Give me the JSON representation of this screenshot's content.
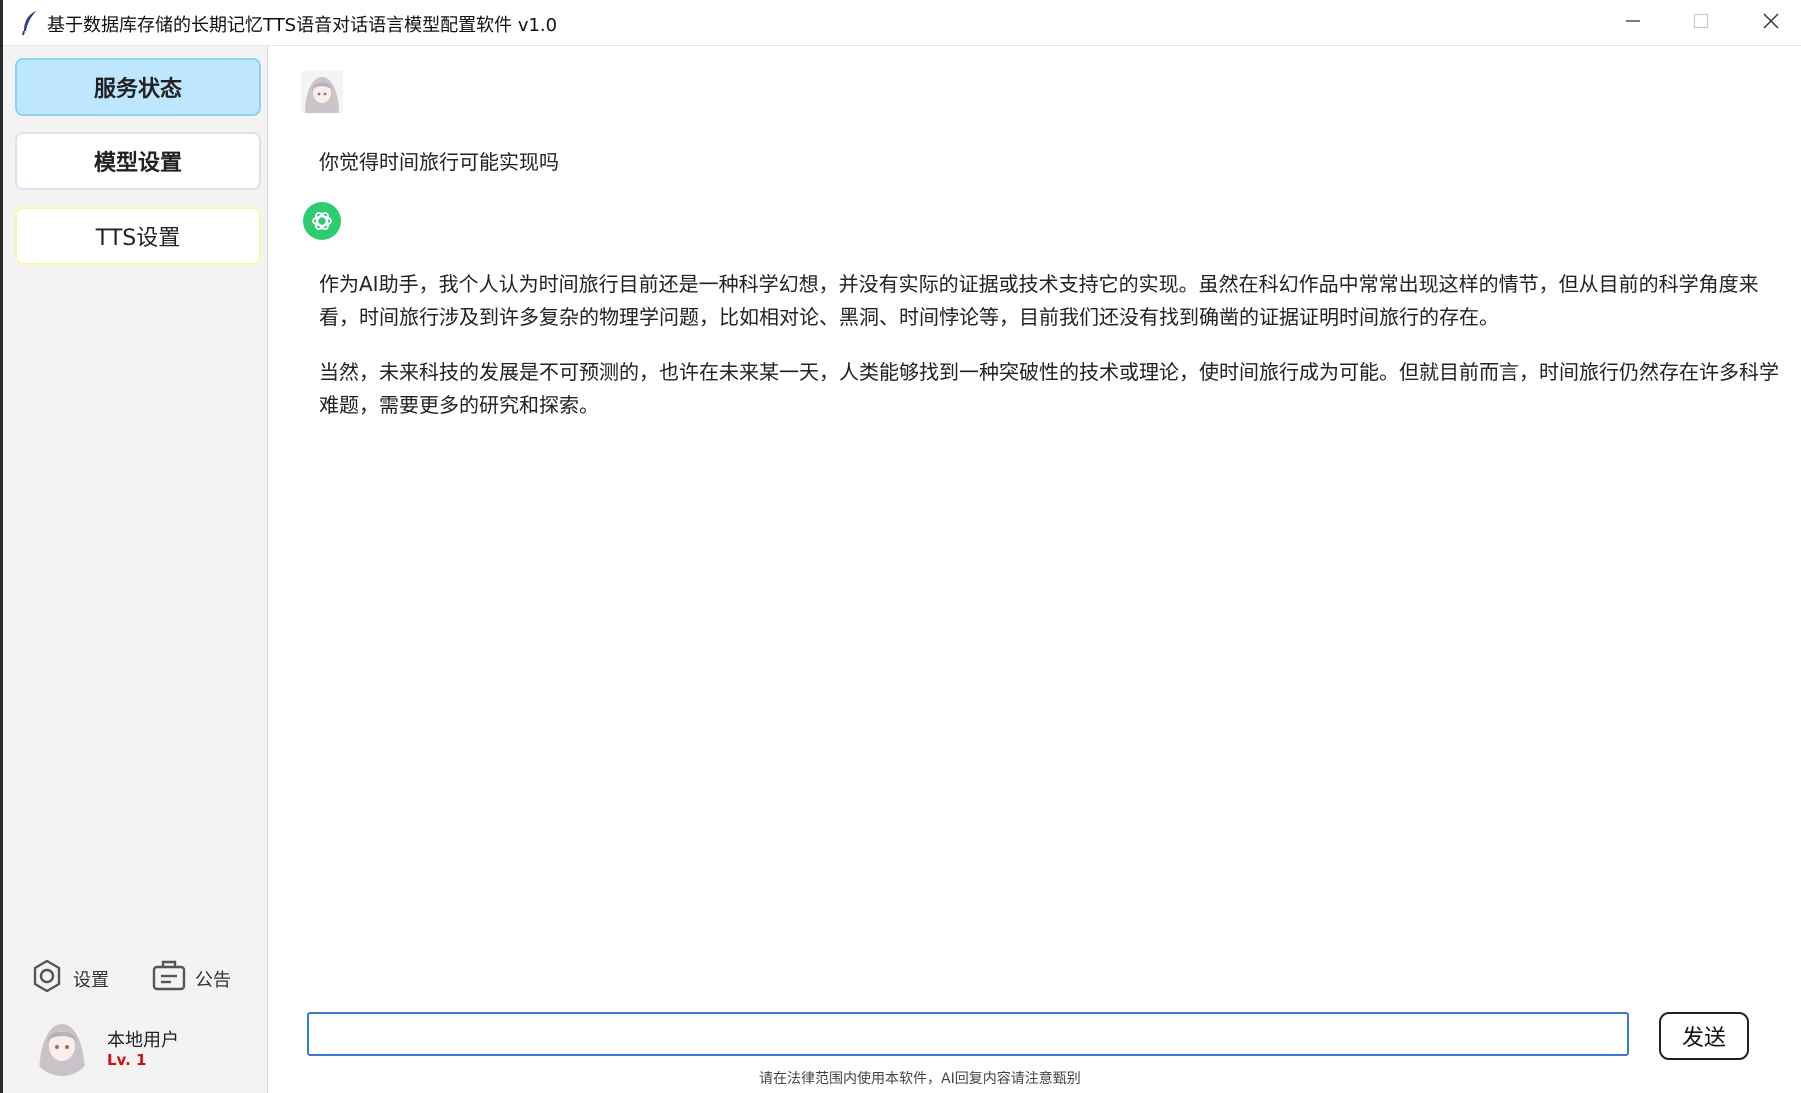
{
  "window": {
    "title": "基于数据库存储的长期记忆TTS语音对话语言模型配置软件 v1.0",
    "app_icon": "feather-icon",
    "controls": [
      "minimize-icon",
      "maximize-icon",
      "close-icon"
    ]
  },
  "sidebar": {
    "nav": [
      {
        "label": "服务状态",
        "active": true
      },
      {
        "label": "模型设置",
        "active": false
      },
      {
        "label": "TTS设置",
        "active": false
      }
    ],
    "tools": {
      "settings_label": "设置",
      "notice_label": "公告"
    },
    "user": {
      "name": "本地用户",
      "level": "Lv. 1"
    }
  },
  "chat": {
    "user_message": "你觉得时间旅行可能实现吗",
    "ai_message_paragraphs": [
      "作为AI助手，我个人认为时间旅行目前还是一种科学幻想，并没有实际的证据或技术支持它的实现。虽然在科幻作品中常常出现这样的情节，但从目前的科学角度来看，时间旅行涉及到许多复杂的物理学问题，比如相对论、黑洞、时间悖论等，目前我们还没有找到确凿的证据证明时间旅行的存在。",
      "当然，未来科技的发展是不可预测的，也许在未来某一天，人类能够找到一种突破性的技术或理论，使时间旅行成为可能。但就目前而言，时间旅行仍然存在许多科学难题，需要更多的研究和探索。"
    ],
    "input_value": "",
    "send_label": "发送",
    "disclaimer": "请在法律范围内使用本软件，AI回复内容请注意甄别"
  },
  "colors": {
    "active_nav_bg": "#bfe6ff",
    "ai_avatar": "#2ecc71",
    "input_border": "#3c78d8",
    "level_text": "#d01010"
  }
}
